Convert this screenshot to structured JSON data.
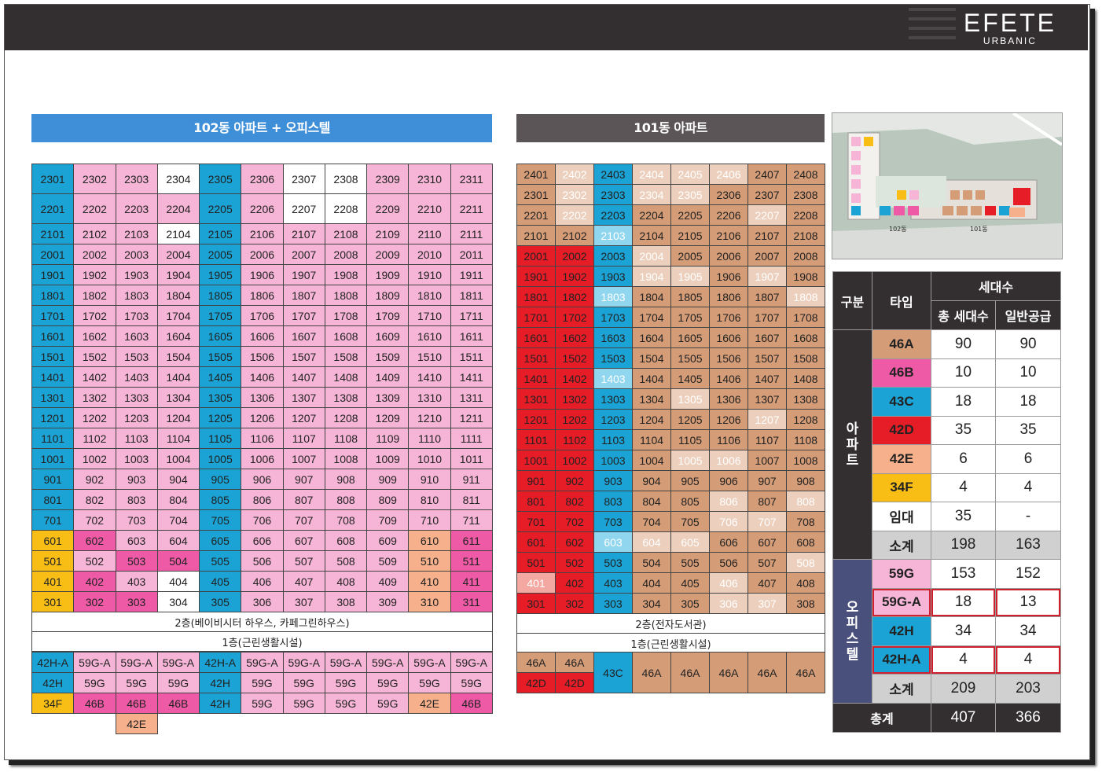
{
  "brand": {
    "main": "EFETE",
    "sub": "URBANIC"
  },
  "building102": {
    "title": "102동 아파트 + 오피스텔",
    "floors": [
      "23",
      "22",
      "21",
      "20",
      "19",
      "18",
      "17",
      "16",
      "15",
      "14",
      "13",
      "12",
      "11",
      "10",
      "9",
      "8",
      "7",
      "6",
      "5",
      "4",
      "3"
    ],
    "units": [
      "01",
      "02",
      "03",
      "04",
      "05",
      "06",
      "07",
      "08",
      "09",
      "10",
      "11"
    ],
    "note2f": "2층(베이비시터 하우스, 카페그린하우스)",
    "note1f": "1층(근린생활시설)",
    "types_row1": [
      "42H-A",
      "59G-A",
      "59G-A",
      "59G-A",
      "42H-A",
      "59G-A",
      "59G-A",
      "59G-A",
      "59G-A",
      "59G-A",
      "59G-A"
    ],
    "types_row2": [
      "42H",
      "59G",
      "59G",
      "59G",
      "42H",
      "59G",
      "59G",
      "59G",
      "59G",
      "59G",
      "59G"
    ],
    "types_row3": [
      "34F",
      "46B",
      "46B",
      "46B",
      "42H",
      "59G",
      "59G",
      "59G",
      "59G",
      "42E",
      "46B"
    ],
    "types_row4": [
      "",
      "",
      "42E",
      "",
      "",
      "",
      "",
      "",
      "",
      "",
      ""
    ]
  },
  "building101": {
    "title": "101동 아파트",
    "floors": [
      "24",
      "23",
      "22",
      "21",
      "20",
      "19",
      "18",
      "17",
      "16",
      "15",
      "14",
      "13",
      "12",
      "11",
      "10",
      "9",
      "8",
      "7",
      "6",
      "5",
      "4",
      "3"
    ],
    "units": [
      "01",
      "02",
      "03",
      "04",
      "05",
      "06",
      "07",
      "08"
    ],
    "note2f": "2층(전자도서관)",
    "note1f": "1층(근린생활시설)",
    "types_a": [
      "46A",
      "46A"
    ],
    "types_b": [
      "42D",
      "42D"
    ],
    "types_rest": [
      "43C",
      "46A",
      "46A",
      "46A",
      "46A",
      "46A"
    ]
  },
  "summary": {
    "header": {
      "gubun": "구분",
      "type": "타입",
      "households": "세대수",
      "total": "총 세대수",
      "general": "일반공급"
    },
    "apt_label": "아파트",
    "office_label": "오피스텔",
    "apt_rows": [
      {
        "type": "46A",
        "total": "90",
        "general": "90",
        "color": "#d49c77"
      },
      {
        "type": "46B",
        "total": "10",
        "general": "10",
        "color": "#ef5aa6"
      },
      {
        "type": "43C",
        "total": "18",
        "general": "18",
        "color": "#1ba3d5"
      },
      {
        "type": "42D",
        "total": "35",
        "general": "35",
        "color": "#e61c27"
      },
      {
        "type": "42E",
        "total": "6",
        "general": "6",
        "color": "#f6b08c"
      },
      {
        "type": "34F",
        "total": "4",
        "general": "4",
        "color": "#f8be16"
      },
      {
        "type": "임대",
        "total": "35",
        "general": "-",
        "color": "#ffffff"
      }
    ],
    "apt_subtotal": {
      "label": "소계",
      "total": "198",
      "general": "163"
    },
    "office_rows": [
      {
        "type": "59G",
        "total": "153",
        "general": "152",
        "color": "#f6b5d6"
      },
      {
        "type": "59G-A",
        "total": "18",
        "general": "13",
        "color": "#f6b5d6"
      },
      {
        "type": "42H",
        "total": "34",
        "general": "34",
        "color": "#1ba3d5"
      },
      {
        "type": "42H-A",
        "total": "4",
        "general": "4",
        "color": "#1ba3d5"
      }
    ],
    "office_subtotal": {
      "label": "소계",
      "total": "209",
      "general": "203"
    },
    "grand_total": {
      "label": "총계",
      "total": "407",
      "general": "366"
    }
  },
  "siteplan": {
    "label_102": "102동",
    "label_101": "101동"
  }
}
